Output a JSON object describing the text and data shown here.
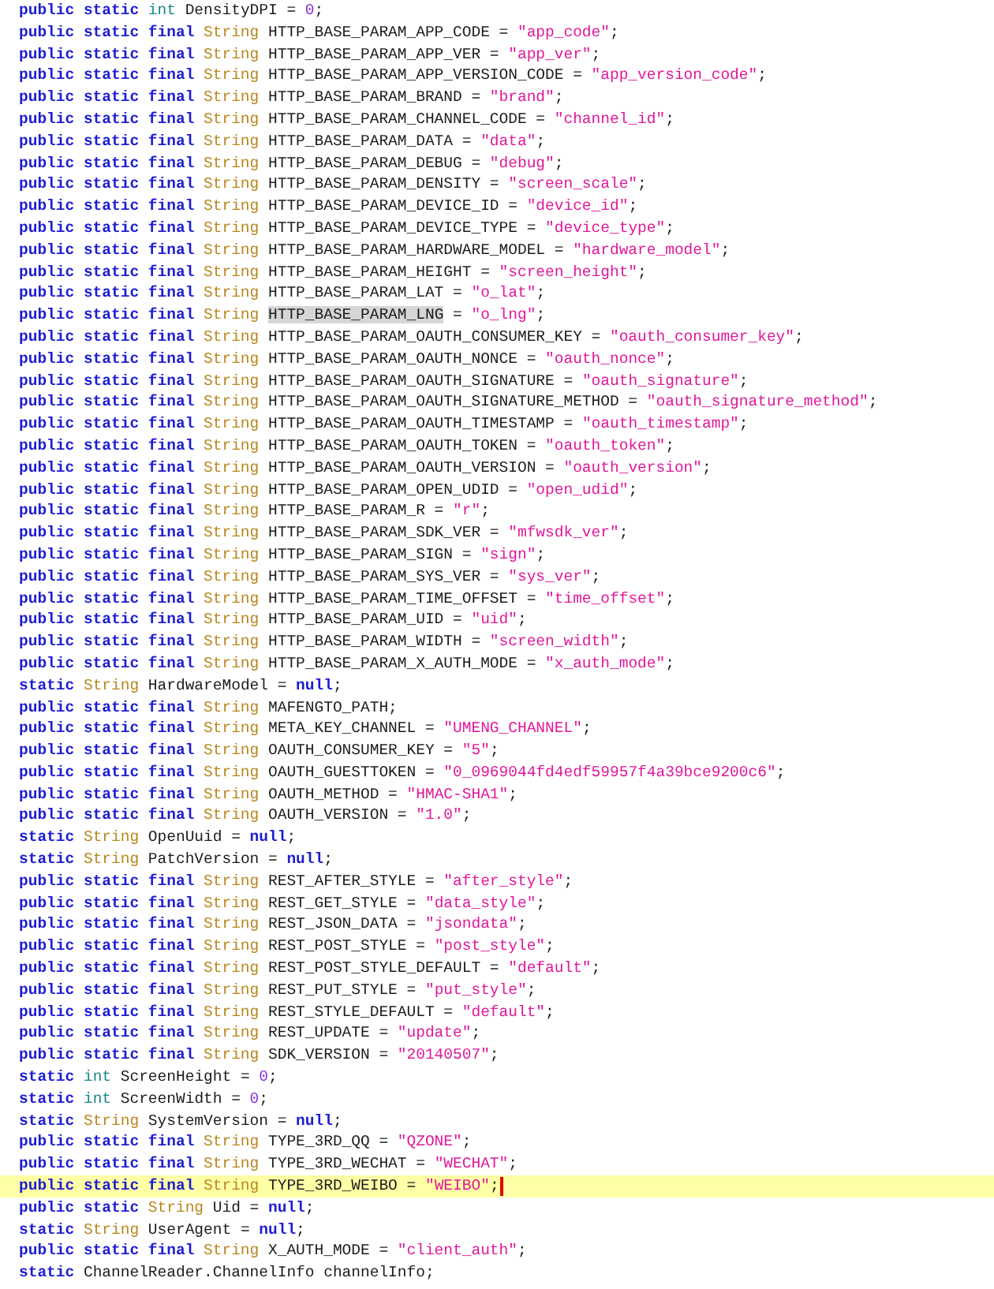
{
  "lines": [
    {
      "current": false,
      "tokens": [
        {
          "kind": "keyword",
          "text": "public static "
        },
        {
          "kind": "primitive",
          "text": "int"
        },
        {
          "kind": "plain",
          "text": " DensityDPI = "
        },
        {
          "kind": "number",
          "text": "0"
        },
        {
          "kind": "plain",
          "text": ";"
        }
      ]
    },
    {
      "current": false,
      "tokens": [
        {
          "kind": "keyword",
          "text": "public static final "
        },
        {
          "kind": "type",
          "text": "String"
        },
        {
          "kind": "plain",
          "text": " HTTP_BASE_PARAM_APP_CODE = "
        },
        {
          "kind": "string",
          "text": "\"app_code\""
        },
        {
          "kind": "plain",
          "text": ";"
        }
      ]
    },
    {
      "current": false,
      "tokens": [
        {
          "kind": "keyword",
          "text": "public static final "
        },
        {
          "kind": "type",
          "text": "String"
        },
        {
          "kind": "plain",
          "text": " HTTP_BASE_PARAM_APP_VER = "
        },
        {
          "kind": "string",
          "text": "\"app_ver\""
        },
        {
          "kind": "plain",
          "text": ";"
        }
      ]
    },
    {
      "current": false,
      "tokens": [
        {
          "kind": "keyword",
          "text": "public static final "
        },
        {
          "kind": "type",
          "text": "String"
        },
        {
          "kind": "plain",
          "text": " HTTP_BASE_PARAM_APP_VERSION_CODE = "
        },
        {
          "kind": "string",
          "text": "\"app_version_code\""
        },
        {
          "kind": "plain",
          "text": ";"
        }
      ]
    },
    {
      "current": false,
      "tokens": [
        {
          "kind": "keyword",
          "text": "public static final "
        },
        {
          "kind": "type",
          "text": "String"
        },
        {
          "kind": "plain",
          "text": " HTTP_BASE_PARAM_BRAND = "
        },
        {
          "kind": "string",
          "text": "\"brand\""
        },
        {
          "kind": "plain",
          "text": ";"
        }
      ]
    },
    {
      "current": false,
      "tokens": [
        {
          "kind": "keyword",
          "text": "public static final "
        },
        {
          "kind": "type",
          "text": "String"
        },
        {
          "kind": "plain",
          "text": " HTTP_BASE_PARAM_CHANNEL_CODE = "
        },
        {
          "kind": "string",
          "text": "\"channel_id\""
        },
        {
          "kind": "plain",
          "text": ";"
        }
      ]
    },
    {
      "current": false,
      "tokens": [
        {
          "kind": "keyword",
          "text": "public static final "
        },
        {
          "kind": "type",
          "text": "String"
        },
        {
          "kind": "plain",
          "text": " HTTP_BASE_PARAM_DATA = "
        },
        {
          "kind": "string",
          "text": "\"data\""
        },
        {
          "kind": "plain",
          "text": ";"
        }
      ]
    },
    {
      "current": false,
      "tokens": [
        {
          "kind": "keyword",
          "text": "public static final "
        },
        {
          "kind": "type",
          "text": "String"
        },
        {
          "kind": "plain",
          "text": " HTTP_BASE_PARAM_DEBUG = "
        },
        {
          "kind": "string",
          "text": "\"debug\""
        },
        {
          "kind": "plain",
          "text": ";"
        }
      ]
    },
    {
      "current": false,
      "tokens": [
        {
          "kind": "keyword",
          "text": "public static final "
        },
        {
          "kind": "type",
          "text": "String"
        },
        {
          "kind": "plain",
          "text": " HTTP_BASE_PARAM_DENSITY = "
        },
        {
          "kind": "string",
          "text": "\"screen_scale\""
        },
        {
          "kind": "plain",
          "text": ";"
        }
      ]
    },
    {
      "current": false,
      "tokens": [
        {
          "kind": "keyword",
          "text": "public static final "
        },
        {
          "kind": "type",
          "text": "String"
        },
        {
          "kind": "plain",
          "text": " HTTP_BASE_PARAM_DEVICE_ID = "
        },
        {
          "kind": "string",
          "text": "\"device_id\""
        },
        {
          "kind": "plain",
          "text": ";"
        }
      ]
    },
    {
      "current": false,
      "tokens": [
        {
          "kind": "keyword",
          "text": "public static final "
        },
        {
          "kind": "type",
          "text": "String"
        },
        {
          "kind": "plain",
          "text": " HTTP_BASE_PARAM_DEVICE_TYPE = "
        },
        {
          "kind": "string",
          "text": "\"device_type\""
        },
        {
          "kind": "plain",
          "text": ";"
        }
      ]
    },
    {
      "current": false,
      "tokens": [
        {
          "kind": "keyword",
          "text": "public static final "
        },
        {
          "kind": "type",
          "text": "String"
        },
        {
          "kind": "plain",
          "text": " HTTP_BASE_PARAM_HARDWARE_MODEL = "
        },
        {
          "kind": "string",
          "text": "\"hardware_model\""
        },
        {
          "kind": "plain",
          "text": ";"
        }
      ]
    },
    {
      "current": false,
      "tokens": [
        {
          "kind": "keyword",
          "text": "public static final "
        },
        {
          "kind": "type",
          "text": "String"
        },
        {
          "kind": "plain",
          "text": " HTTP_BASE_PARAM_HEIGHT = "
        },
        {
          "kind": "string",
          "text": "\"screen_height\""
        },
        {
          "kind": "plain",
          "text": ";"
        }
      ]
    },
    {
      "current": false,
      "tokens": [
        {
          "kind": "keyword",
          "text": "public static final "
        },
        {
          "kind": "type",
          "text": "String"
        },
        {
          "kind": "plain",
          "text": " HTTP_BASE_PARAM_LAT = "
        },
        {
          "kind": "string",
          "text": "\"o_lat\""
        },
        {
          "kind": "plain",
          "text": ";"
        }
      ]
    },
    {
      "current": false,
      "tokens": [
        {
          "kind": "keyword",
          "text": "public static final "
        },
        {
          "kind": "type",
          "text": "String "
        },
        {
          "kind": "selected",
          "text": "HTTP_BASE_PARAM_LNG"
        },
        {
          "kind": "plain",
          "text": " = "
        },
        {
          "kind": "string",
          "text": "\"o_lng\""
        },
        {
          "kind": "plain",
          "text": ";"
        }
      ]
    },
    {
      "current": false,
      "tokens": [
        {
          "kind": "keyword",
          "text": "public static final "
        },
        {
          "kind": "type",
          "text": "String"
        },
        {
          "kind": "plain",
          "text": " HTTP_BASE_PARAM_OAUTH_CONSUMER_KEY = "
        },
        {
          "kind": "string",
          "text": "\"oauth_consumer_key\""
        },
        {
          "kind": "plain",
          "text": ";"
        }
      ]
    },
    {
      "current": false,
      "tokens": [
        {
          "kind": "keyword",
          "text": "public static final "
        },
        {
          "kind": "type",
          "text": "String"
        },
        {
          "kind": "plain",
          "text": " HTTP_BASE_PARAM_OAUTH_NONCE = "
        },
        {
          "kind": "string",
          "text": "\"oauth_nonce\""
        },
        {
          "kind": "plain",
          "text": ";"
        }
      ]
    },
    {
      "current": false,
      "tokens": [
        {
          "kind": "keyword",
          "text": "public static final "
        },
        {
          "kind": "type",
          "text": "String"
        },
        {
          "kind": "plain",
          "text": " HTTP_BASE_PARAM_OAUTH_SIGNATURE = "
        },
        {
          "kind": "string",
          "text": "\"oauth_signature\""
        },
        {
          "kind": "plain",
          "text": ";"
        }
      ]
    },
    {
      "current": false,
      "tokens": [
        {
          "kind": "keyword",
          "text": "public static final "
        },
        {
          "kind": "type",
          "text": "String"
        },
        {
          "kind": "plain",
          "text": " HTTP_BASE_PARAM_OAUTH_SIGNATURE_METHOD = "
        },
        {
          "kind": "string",
          "text": "\"oauth_signature_method\""
        },
        {
          "kind": "plain",
          "text": ";"
        }
      ]
    },
    {
      "current": false,
      "tokens": [
        {
          "kind": "keyword",
          "text": "public static final "
        },
        {
          "kind": "type",
          "text": "String"
        },
        {
          "kind": "plain",
          "text": " HTTP_BASE_PARAM_OAUTH_TIMESTAMP = "
        },
        {
          "kind": "string",
          "text": "\"oauth_timestamp\""
        },
        {
          "kind": "plain",
          "text": ";"
        }
      ]
    },
    {
      "current": false,
      "tokens": [
        {
          "kind": "keyword",
          "text": "public static final "
        },
        {
          "kind": "type",
          "text": "String"
        },
        {
          "kind": "plain",
          "text": " HTTP_BASE_PARAM_OAUTH_TOKEN = "
        },
        {
          "kind": "string",
          "text": "\"oauth_token\""
        },
        {
          "kind": "plain",
          "text": ";"
        }
      ]
    },
    {
      "current": false,
      "tokens": [
        {
          "kind": "keyword",
          "text": "public static final "
        },
        {
          "kind": "type",
          "text": "String"
        },
        {
          "kind": "plain",
          "text": " HTTP_BASE_PARAM_OAUTH_VERSION = "
        },
        {
          "kind": "string",
          "text": "\"oauth_version\""
        },
        {
          "kind": "plain",
          "text": ";"
        }
      ]
    },
    {
      "current": false,
      "tokens": [
        {
          "kind": "keyword",
          "text": "public static final "
        },
        {
          "kind": "type",
          "text": "String"
        },
        {
          "kind": "plain",
          "text": " HTTP_BASE_PARAM_OPEN_UDID = "
        },
        {
          "kind": "string",
          "text": "\"open_udid\""
        },
        {
          "kind": "plain",
          "text": ";"
        }
      ]
    },
    {
      "current": false,
      "tokens": [
        {
          "kind": "keyword",
          "text": "public static final "
        },
        {
          "kind": "type",
          "text": "String"
        },
        {
          "kind": "plain",
          "text": " HTTP_BASE_PARAM_R = "
        },
        {
          "kind": "string",
          "text": "\"r\""
        },
        {
          "kind": "plain",
          "text": ";"
        }
      ]
    },
    {
      "current": false,
      "tokens": [
        {
          "kind": "keyword",
          "text": "public static final "
        },
        {
          "kind": "type",
          "text": "String"
        },
        {
          "kind": "plain",
          "text": " HTTP_BASE_PARAM_SDK_VER = "
        },
        {
          "kind": "string",
          "text": "\"mfwsdk_ver\""
        },
        {
          "kind": "plain",
          "text": ";"
        }
      ]
    },
    {
      "current": false,
      "tokens": [
        {
          "kind": "keyword",
          "text": "public static final "
        },
        {
          "kind": "type",
          "text": "String"
        },
        {
          "kind": "plain",
          "text": " HTTP_BASE_PARAM_SIGN = "
        },
        {
          "kind": "string",
          "text": "\"sign\""
        },
        {
          "kind": "plain",
          "text": ";"
        }
      ]
    },
    {
      "current": false,
      "tokens": [
        {
          "kind": "keyword",
          "text": "public static final "
        },
        {
          "kind": "type",
          "text": "String"
        },
        {
          "kind": "plain",
          "text": " HTTP_BASE_PARAM_SYS_VER = "
        },
        {
          "kind": "string",
          "text": "\"sys_ver\""
        },
        {
          "kind": "plain",
          "text": ";"
        }
      ]
    },
    {
      "current": false,
      "tokens": [
        {
          "kind": "keyword",
          "text": "public static final "
        },
        {
          "kind": "type",
          "text": "String"
        },
        {
          "kind": "plain",
          "text": " HTTP_BASE_PARAM_TIME_OFFSET = "
        },
        {
          "kind": "string",
          "text": "\"time_offset\""
        },
        {
          "kind": "plain",
          "text": ";"
        }
      ]
    },
    {
      "current": false,
      "tokens": [
        {
          "kind": "keyword",
          "text": "public static final "
        },
        {
          "kind": "type",
          "text": "String"
        },
        {
          "kind": "plain",
          "text": " HTTP_BASE_PARAM_UID = "
        },
        {
          "kind": "string",
          "text": "\"uid\""
        },
        {
          "kind": "plain",
          "text": ";"
        }
      ]
    },
    {
      "current": false,
      "tokens": [
        {
          "kind": "keyword",
          "text": "public static final "
        },
        {
          "kind": "type",
          "text": "String"
        },
        {
          "kind": "plain",
          "text": " HTTP_BASE_PARAM_WIDTH = "
        },
        {
          "kind": "string",
          "text": "\"screen_width\""
        },
        {
          "kind": "plain",
          "text": ";"
        }
      ]
    },
    {
      "current": false,
      "tokens": [
        {
          "kind": "keyword",
          "text": "public static final "
        },
        {
          "kind": "type",
          "text": "String"
        },
        {
          "kind": "plain",
          "text": " HTTP_BASE_PARAM_X_AUTH_MODE = "
        },
        {
          "kind": "string",
          "text": "\"x_auth_mode\""
        },
        {
          "kind": "plain",
          "text": ";"
        }
      ]
    },
    {
      "current": false,
      "tokens": [
        {
          "kind": "keyword",
          "text": "static "
        },
        {
          "kind": "type",
          "text": "String"
        },
        {
          "kind": "plain",
          "text": " HardwareModel = "
        },
        {
          "kind": "keyword",
          "text": "null"
        },
        {
          "kind": "plain",
          "text": ";"
        }
      ]
    },
    {
      "current": false,
      "tokens": [
        {
          "kind": "keyword",
          "text": "public static final "
        },
        {
          "kind": "type",
          "text": "String"
        },
        {
          "kind": "plain",
          "text": " MAFENGTO_PATH;"
        }
      ]
    },
    {
      "current": false,
      "tokens": [
        {
          "kind": "keyword",
          "text": "public static final "
        },
        {
          "kind": "type",
          "text": "String"
        },
        {
          "kind": "plain",
          "text": " META_KEY_CHANNEL = "
        },
        {
          "kind": "string",
          "text": "\"UMENG_CHANNEL\""
        },
        {
          "kind": "plain",
          "text": ";"
        }
      ]
    },
    {
      "current": false,
      "tokens": [
        {
          "kind": "keyword",
          "text": "public static final "
        },
        {
          "kind": "type",
          "text": "String"
        },
        {
          "kind": "plain",
          "text": " OAUTH_CONSUMER_KEY = "
        },
        {
          "kind": "string",
          "text": "\"5\""
        },
        {
          "kind": "plain",
          "text": ";"
        }
      ]
    },
    {
      "current": false,
      "tokens": [
        {
          "kind": "keyword",
          "text": "public static final "
        },
        {
          "kind": "type",
          "text": "String"
        },
        {
          "kind": "plain",
          "text": " OAUTH_GUESTTOKEN = "
        },
        {
          "kind": "string",
          "text": "\"0_0969044fd4edf59957f4a39bce9200c6\""
        },
        {
          "kind": "plain",
          "text": ";"
        }
      ]
    },
    {
      "current": false,
      "tokens": [
        {
          "kind": "keyword",
          "text": "public static final "
        },
        {
          "kind": "type",
          "text": "String"
        },
        {
          "kind": "plain",
          "text": " OAUTH_METHOD = "
        },
        {
          "kind": "string",
          "text": "\"HMAC-SHA1\""
        },
        {
          "kind": "plain",
          "text": ";"
        }
      ]
    },
    {
      "current": false,
      "tokens": [
        {
          "kind": "keyword",
          "text": "public static final "
        },
        {
          "kind": "type",
          "text": "String"
        },
        {
          "kind": "plain",
          "text": " OAUTH_VERSION = "
        },
        {
          "kind": "string",
          "text": "\"1.0\""
        },
        {
          "kind": "plain",
          "text": ";"
        }
      ]
    },
    {
      "current": false,
      "tokens": [
        {
          "kind": "keyword",
          "text": "static "
        },
        {
          "kind": "type",
          "text": "String"
        },
        {
          "kind": "plain",
          "text": " OpenUuid = "
        },
        {
          "kind": "keyword",
          "text": "null"
        },
        {
          "kind": "plain",
          "text": ";"
        }
      ]
    },
    {
      "current": false,
      "tokens": [
        {
          "kind": "keyword",
          "text": "static "
        },
        {
          "kind": "type",
          "text": "String"
        },
        {
          "kind": "plain",
          "text": " PatchVersion = "
        },
        {
          "kind": "keyword",
          "text": "null"
        },
        {
          "kind": "plain",
          "text": ";"
        }
      ]
    },
    {
      "current": false,
      "tokens": [
        {
          "kind": "keyword",
          "text": "public static final "
        },
        {
          "kind": "type",
          "text": "String"
        },
        {
          "kind": "plain",
          "text": " REST_AFTER_STYLE = "
        },
        {
          "kind": "string",
          "text": "\"after_style\""
        },
        {
          "kind": "plain",
          "text": ";"
        }
      ]
    },
    {
      "current": false,
      "tokens": [
        {
          "kind": "keyword",
          "text": "public static final "
        },
        {
          "kind": "type",
          "text": "String"
        },
        {
          "kind": "plain",
          "text": " REST_GET_STYLE = "
        },
        {
          "kind": "string",
          "text": "\"data_style\""
        },
        {
          "kind": "plain",
          "text": ";"
        }
      ]
    },
    {
      "current": false,
      "tokens": [
        {
          "kind": "keyword",
          "text": "public static final "
        },
        {
          "kind": "type",
          "text": "String"
        },
        {
          "kind": "plain",
          "text": " REST_JSON_DATA = "
        },
        {
          "kind": "string",
          "text": "\"jsondata\""
        },
        {
          "kind": "plain",
          "text": ";"
        }
      ]
    },
    {
      "current": false,
      "tokens": [
        {
          "kind": "keyword",
          "text": "public static final "
        },
        {
          "kind": "type",
          "text": "String"
        },
        {
          "kind": "plain",
          "text": " REST_POST_STYLE = "
        },
        {
          "kind": "string",
          "text": "\"post_style\""
        },
        {
          "kind": "plain",
          "text": ";"
        }
      ]
    },
    {
      "current": false,
      "tokens": [
        {
          "kind": "keyword",
          "text": "public static final "
        },
        {
          "kind": "type",
          "text": "String"
        },
        {
          "kind": "plain",
          "text": " REST_POST_STYLE_DEFAULT = "
        },
        {
          "kind": "string",
          "text": "\"default\""
        },
        {
          "kind": "plain",
          "text": ";"
        }
      ]
    },
    {
      "current": false,
      "tokens": [
        {
          "kind": "keyword",
          "text": "public static final "
        },
        {
          "kind": "type",
          "text": "String"
        },
        {
          "kind": "plain",
          "text": " REST_PUT_STYLE = "
        },
        {
          "kind": "string",
          "text": "\"put_style\""
        },
        {
          "kind": "plain",
          "text": ";"
        }
      ]
    },
    {
      "current": false,
      "tokens": [
        {
          "kind": "keyword",
          "text": "public static final "
        },
        {
          "kind": "type",
          "text": "String"
        },
        {
          "kind": "plain",
          "text": " REST_STYLE_DEFAULT = "
        },
        {
          "kind": "string",
          "text": "\"default\""
        },
        {
          "kind": "plain",
          "text": ";"
        }
      ]
    },
    {
      "current": false,
      "tokens": [
        {
          "kind": "keyword",
          "text": "public static final "
        },
        {
          "kind": "type",
          "text": "String"
        },
        {
          "kind": "plain",
          "text": " REST_UPDATE = "
        },
        {
          "kind": "string",
          "text": "\"update\""
        },
        {
          "kind": "plain",
          "text": ";"
        }
      ]
    },
    {
      "current": false,
      "tokens": [
        {
          "kind": "keyword",
          "text": "public static final "
        },
        {
          "kind": "type",
          "text": "String"
        },
        {
          "kind": "plain",
          "text": " SDK_VERSION = "
        },
        {
          "kind": "string",
          "text": "\"20140507\""
        },
        {
          "kind": "plain",
          "text": ";"
        }
      ]
    },
    {
      "current": false,
      "tokens": [
        {
          "kind": "keyword",
          "text": "static "
        },
        {
          "kind": "primitive",
          "text": "int"
        },
        {
          "kind": "plain",
          "text": " ScreenHeight = "
        },
        {
          "kind": "number",
          "text": "0"
        },
        {
          "kind": "plain",
          "text": ";"
        }
      ]
    },
    {
      "current": false,
      "tokens": [
        {
          "kind": "keyword",
          "text": "static "
        },
        {
          "kind": "primitive",
          "text": "int"
        },
        {
          "kind": "plain",
          "text": " ScreenWidth = "
        },
        {
          "kind": "number",
          "text": "0"
        },
        {
          "kind": "plain",
          "text": ";"
        }
      ]
    },
    {
      "current": false,
      "tokens": [
        {
          "kind": "keyword",
          "text": "static "
        },
        {
          "kind": "type",
          "text": "String"
        },
        {
          "kind": "plain",
          "text": " SystemVersion = "
        },
        {
          "kind": "keyword",
          "text": "null"
        },
        {
          "kind": "plain",
          "text": ";"
        }
      ]
    },
    {
      "current": false,
      "tokens": [
        {
          "kind": "keyword",
          "text": "public static final "
        },
        {
          "kind": "type",
          "text": "String"
        },
        {
          "kind": "plain",
          "text": " TYPE_3RD_QQ = "
        },
        {
          "kind": "string",
          "text": "\"QZONE\""
        },
        {
          "kind": "plain",
          "text": ";"
        }
      ]
    },
    {
      "current": false,
      "tokens": [
        {
          "kind": "keyword",
          "text": "public static final "
        },
        {
          "kind": "type",
          "text": "String"
        },
        {
          "kind": "plain",
          "text": " TYPE_3RD_WECHAT = "
        },
        {
          "kind": "string",
          "text": "\"WECHAT\""
        },
        {
          "kind": "plain",
          "text": ";"
        }
      ]
    },
    {
      "current": true,
      "tokens": [
        {
          "kind": "keyword",
          "text": "public static final "
        },
        {
          "kind": "type",
          "text": "String"
        },
        {
          "kind": "plain",
          "text": " TYPE_3RD_WEIBO = "
        },
        {
          "kind": "string",
          "text": "\"WEIBO\""
        },
        {
          "kind": "plain",
          "text": ";"
        }
      ]
    },
    {
      "current": false,
      "tokens": [
        {
          "kind": "keyword",
          "text": "public static "
        },
        {
          "kind": "type",
          "text": "String"
        },
        {
          "kind": "plain",
          "text": " Uid = "
        },
        {
          "kind": "keyword",
          "text": "null"
        },
        {
          "kind": "plain",
          "text": ";"
        }
      ]
    },
    {
      "current": false,
      "tokens": [
        {
          "kind": "keyword",
          "text": "static "
        },
        {
          "kind": "type",
          "text": "String"
        },
        {
          "kind": "plain",
          "text": " UserAgent = "
        },
        {
          "kind": "keyword",
          "text": "null"
        },
        {
          "kind": "plain",
          "text": ";"
        }
      ]
    },
    {
      "current": false,
      "tokens": [
        {
          "kind": "keyword",
          "text": "public static final "
        },
        {
          "kind": "type",
          "text": "String"
        },
        {
          "kind": "plain",
          "text": " X_AUTH_MODE = "
        },
        {
          "kind": "string",
          "text": "\"client_auth\""
        },
        {
          "kind": "plain",
          "text": ";"
        }
      ]
    },
    {
      "current": false,
      "tokens": [
        {
          "kind": "keyword",
          "text": "static "
        },
        {
          "kind": "plain",
          "text": "ChannelReader.ChannelInfo channelInfo;"
        }
      ]
    }
  ]
}
